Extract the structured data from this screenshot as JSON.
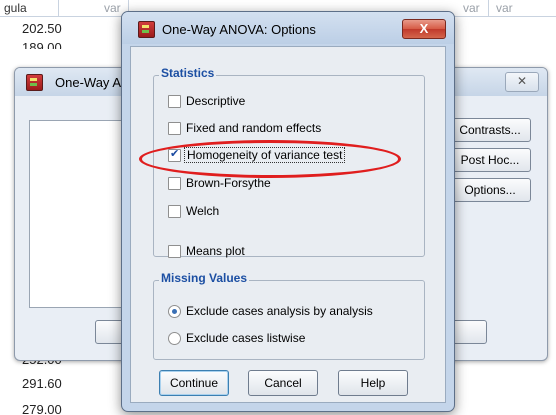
{
  "grid": {
    "columns": [
      "gula",
      "var",
      "var",
      "var",
      "var",
      "var",
      "var"
    ],
    "cells_top": [
      "202.50",
      "189.00"
    ],
    "cells_bottom": [
      "252.00",
      "291.60",
      "279.00"
    ]
  },
  "bg_window": {
    "title": "One-Way ANOV",
    "close_label": "✕",
    "buttons": [
      "Contrasts...",
      "Post Hoc...",
      "Options..."
    ],
    "bottom_left_stub": "O",
    "bottom_right_stub": "lp"
  },
  "dialog": {
    "title": "One-Way ANOVA: Options",
    "close_label": "X",
    "statistics_label": "Statistics",
    "options": [
      {
        "label": "Descriptive",
        "checked": false
      },
      {
        "label": "Fixed and random effects",
        "checked": false
      },
      {
        "label": "Homogeneity of variance test",
        "checked": true
      },
      {
        "label": "Brown-Forsythe",
        "checked": false
      },
      {
        "label": "Welch",
        "checked": false
      }
    ],
    "means_plot_label": "Means plot",
    "missing_label": "Missing Values",
    "missing_options": [
      {
        "label": "Exclude cases analysis by analysis",
        "selected": true
      },
      {
        "label": "Exclude cases listwise",
        "selected": false
      }
    ],
    "continue_label": "Continue",
    "cancel_label": "Cancel",
    "help_label": "Help"
  },
  "colors": {
    "group_label": "#1c4fa3",
    "highlight": "#e01e1e",
    "close_button": "#c0392b"
  }
}
